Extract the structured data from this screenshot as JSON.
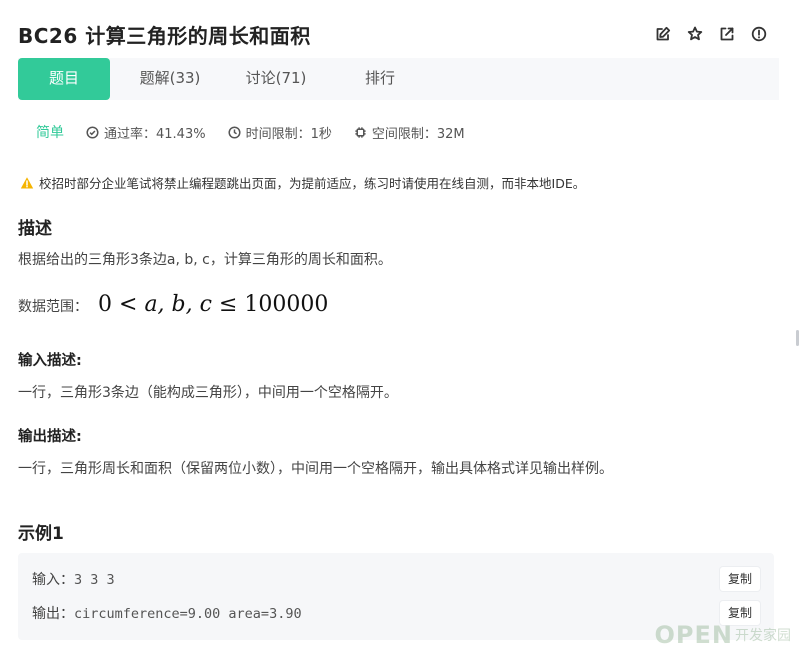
{
  "header": {
    "title": "BC26  计算三角形的周长和面积",
    "actions": [
      {
        "icon": "edit-icon"
      },
      {
        "icon": "star-icon"
      },
      {
        "icon": "share-icon"
      },
      {
        "icon": "info-icon"
      }
    ]
  },
  "tabs": [
    {
      "label": "题目",
      "active": true
    },
    {
      "label": "题解(33)"
    },
    {
      "label": "讨论(71)"
    },
    {
      "label": "排行"
    }
  ],
  "meta": {
    "difficulty": "简单",
    "pass_rate": "通过率：41.43%",
    "time_limit": "时间限制：1秒",
    "memory_limit": "空间限制：32M"
  },
  "notice": "校招时部分企业笔试将禁止编程题跳出页面，为提前适应，练习时请使用在线自测，而非本地IDE。",
  "description": {
    "heading": "描述",
    "text": "根据给出的三角形3条边a, b, c，计算三角形的周长和面积。",
    "range_label": "数据范围：",
    "range_lhs": "0 <",
    "range_vars": "a, b, c",
    "range_rhs": "≤ 100000"
  },
  "input_desc": {
    "heading": "输入描述:",
    "text": "一行，三角形3条边（能构成三角形），中间用一个空格隔开。"
  },
  "output_desc": {
    "heading": "输出描述:",
    "text": "一行，三角形周长和面积（保留两位小数），中间用一个空格隔开，输出具体格式详见输出样例。"
  },
  "example": {
    "heading": "示例1",
    "input_label": "输入：",
    "input_value": "3 3 3",
    "output_label": "输出：",
    "output_value": "circumference=9.00 area=3.90",
    "copy_label": "复制"
  },
  "watermark": {
    "en": "OPEN",
    "cn": "开发家园"
  },
  "colors": {
    "accent": "#32ca99",
    "warning": "#f5b400",
    "tab_bar_bg": "#f7f8fa",
    "example_bg": "#f6f7f9"
  }
}
